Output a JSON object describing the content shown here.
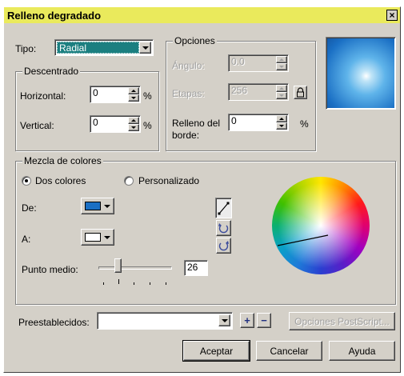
{
  "dialog": {
    "title": "Relleno degradado",
    "close_glyph": "×"
  },
  "tipo": {
    "label": "Tipo:",
    "value": "Radial"
  },
  "opciones": {
    "title": "Opciones",
    "angulo_label": "Ángulo:",
    "angulo_value": "0.0",
    "etapas_label": "Etapas:",
    "etapas_value": "256",
    "borde_label_1": "Relleno del",
    "borde_label_2": "borde:",
    "borde_value": "0",
    "borde_unit": "%"
  },
  "descentrado": {
    "title": "Descentrado",
    "horizontal_label": "Horizontal:",
    "horizontal_value": "0",
    "horizontal_unit": "%",
    "vertical_label": "Vertical:",
    "vertical_value": "0",
    "vertical_unit": "%"
  },
  "mezcla": {
    "title": "Mezcla de colores",
    "radio_dos": "Dos colores",
    "radio_personalizado": "Personalizado",
    "selected": "Dos colores",
    "de_label": "De:",
    "de_color": "#1a6fc4",
    "a_label": "A:",
    "a_color": "#ffffff",
    "punto_label": "Punto medio:",
    "punto_value": "26",
    "path_icons": [
      "direct-path-icon",
      "counterclockwise-path-icon",
      "clockwise-path-icon"
    ]
  },
  "preestablecidos": {
    "label": "Preestablecidos:",
    "value": "",
    "add_glyph": "+",
    "remove_glyph": "−",
    "postscript_label": "Opciones PostScript..."
  },
  "buttons": {
    "aceptar": "Aceptar",
    "cancelar": "Cancelar",
    "ayuda": "Ayuda"
  },
  "colors": {
    "title_bar": "#eaea5c",
    "dialog_bg": "#d4d0c8",
    "tipo_select_bg": "#1b7f80",
    "preview_center": "#ffffff",
    "preview_edge": "#1a6fc4"
  }
}
